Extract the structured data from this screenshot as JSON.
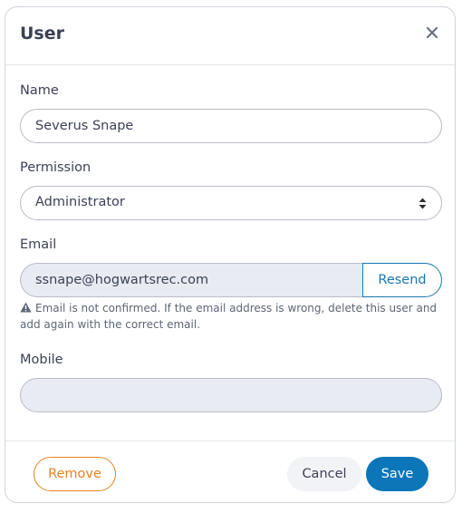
{
  "dialog": {
    "title": "User",
    "close_icon": "close-icon"
  },
  "form": {
    "name": {
      "label": "Name",
      "value": "Severus Snape"
    },
    "permission": {
      "label": "Permission",
      "selected": "Administrator",
      "icon": "select-arrows-icon"
    },
    "email": {
      "label": "Email",
      "value": "ssnape@hogwartsrec.com",
      "resend_label": "Resend",
      "warning_icon": "warning-triangle-icon",
      "note": "Email is not confirmed. If the email address is wrong, delete this user and add again with the correct email."
    },
    "mobile": {
      "label": "Mobile",
      "value": ""
    }
  },
  "footer": {
    "remove_label": "Remove",
    "cancel_label": "Cancel",
    "save_label": "Save"
  },
  "colors": {
    "accent": "#0b76b8",
    "resend": "#1b77b3",
    "remove": "#e8821e",
    "disabled_field": "#e8ebf2"
  }
}
